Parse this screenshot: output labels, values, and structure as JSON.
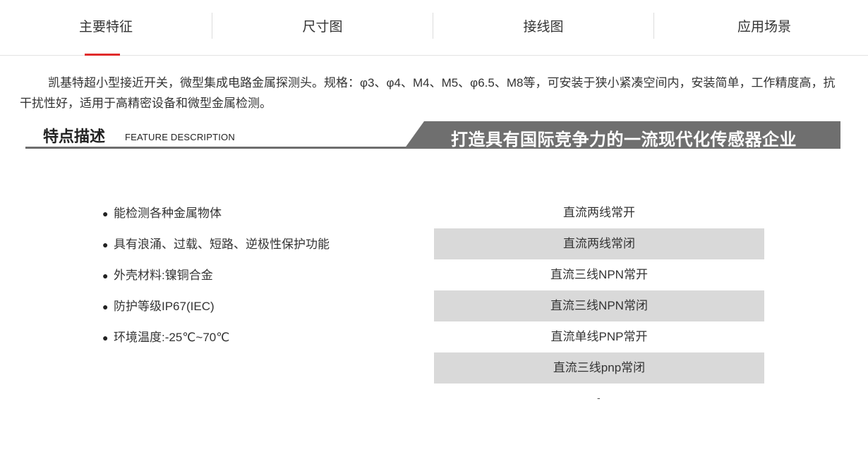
{
  "tabs": [
    {
      "label": "主要特征"
    },
    {
      "label": "尺寸图"
    },
    {
      "label": "接线图"
    },
    {
      "label": "应用场景"
    }
  ],
  "intro": "凯基特超小型接近开关，微型集成电路金属探测头。规格：φ3、φ4、M4、M5、φ6.5、M8等，可安装于狭小紧凑空间内，安装简单，工作精度高，抗干扰性好，适用于高精密设备和微型金属检测。",
  "banner": {
    "title": "特点描述",
    "subtitle": "FEATURE DESCRIPTION",
    "slogan": "打造具有国际竞争力的一流现代化传感器企业"
  },
  "features": {
    "bullet": "●",
    "items": [
      "能检测各种金属物体",
      "具有浪涌、过载、短路、逆极性保护功能",
      "外壳材料:镍铜合金",
      "防护等级IP67(IEC)",
      "环境温度:-25℃~70℃"
    ]
  },
  "output_types": [
    "直流两线常开",
    "直流两线常闭",
    "直流三线NPN常开",
    "直流三线NPN常闭",
    "直流单线PNP常开",
    "直流三线pnp常闭"
  ],
  "trailing_mark": "-",
  "colors": {
    "accent": "#e02b2b",
    "banner_gray": "#6f6f6f",
    "row_shade": "#d9d9d9"
  }
}
